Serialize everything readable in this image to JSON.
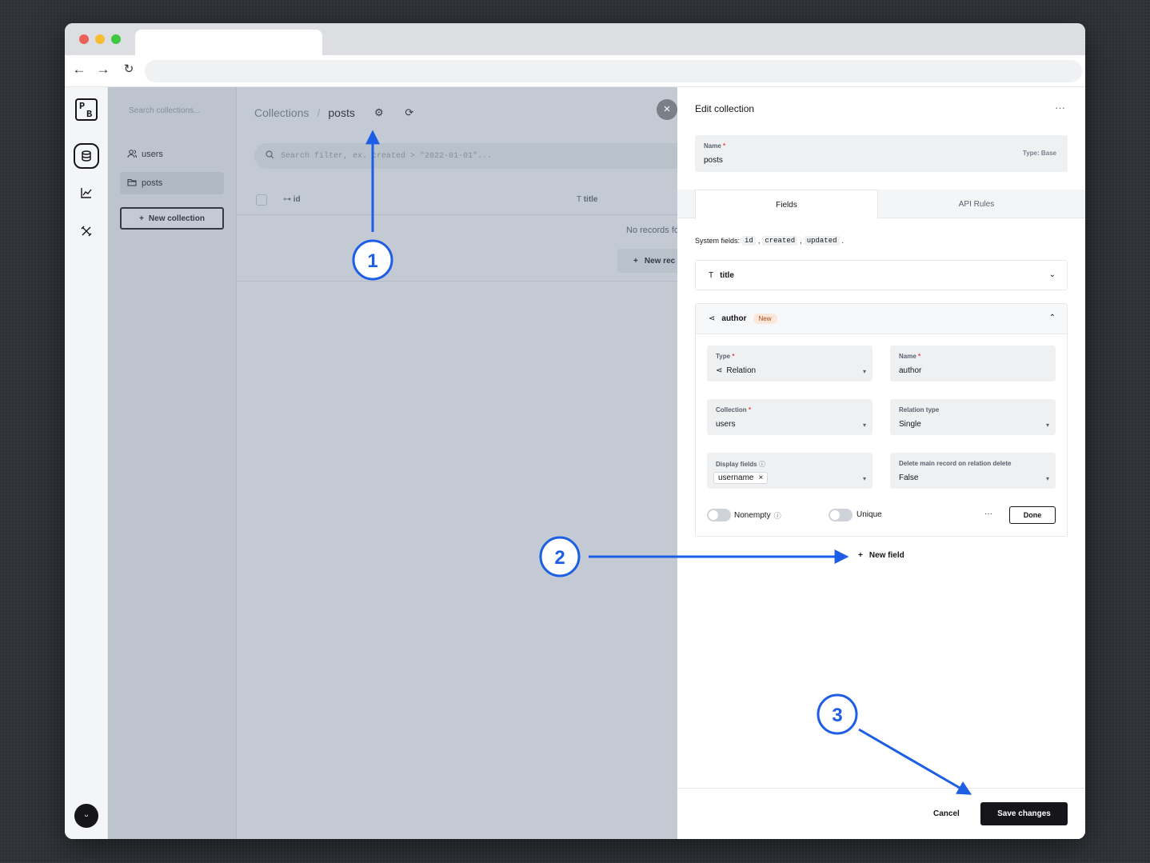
{
  "sidebar": {
    "search_placeholder": "Search collections...",
    "items": [
      {
        "label": "users",
        "icon": "users-icon"
      },
      {
        "label": "posts",
        "icon": "folder-icon"
      }
    ],
    "new_collection_label": "New collection"
  },
  "main": {
    "breadcrumb_root": "Collections",
    "breadcrumb_sep": "/",
    "breadcrumb_current": "posts",
    "search_placeholder": "Search filter, ex. created > \"2022-01-01\"...",
    "columns": [
      "id",
      "title"
    ],
    "empty_text": "No records fo",
    "new_record_label": "New rec"
  },
  "panel": {
    "title": "Edit collection",
    "more": "···",
    "name_label": "Name",
    "name_value": "posts",
    "type_label": "Type: Base",
    "tabs": [
      "Fields",
      "API Rules"
    ],
    "system_fields_label": "System fields:",
    "system_fields": [
      "id",
      "created",
      "updated"
    ],
    "fields": [
      {
        "name": "title",
        "icon": "text-icon"
      },
      {
        "name": "author",
        "icon": "relation-icon",
        "badge": "New"
      }
    ],
    "author": {
      "type_label": "Type",
      "type_value": "Relation",
      "name_label": "Name",
      "name_value": "author",
      "collection_label": "Collection",
      "collection_value": "users",
      "relation_type_label": "Relation type",
      "relation_type_value": "Single",
      "display_fields_label": "Display fields",
      "display_fields_chip": "username",
      "delete_label": "Delete main record on relation delete",
      "delete_value": "False",
      "nonempty_label": "Nonempty",
      "unique_label": "Unique",
      "more": "···",
      "done_label": "Done"
    },
    "new_field_label": "New field",
    "cancel_label": "Cancel",
    "save_label": "Save changes"
  },
  "annotations": [
    "1",
    "2",
    "3"
  ],
  "colors": {
    "accent": "#1d5ee6",
    "dark": "#16161a"
  }
}
